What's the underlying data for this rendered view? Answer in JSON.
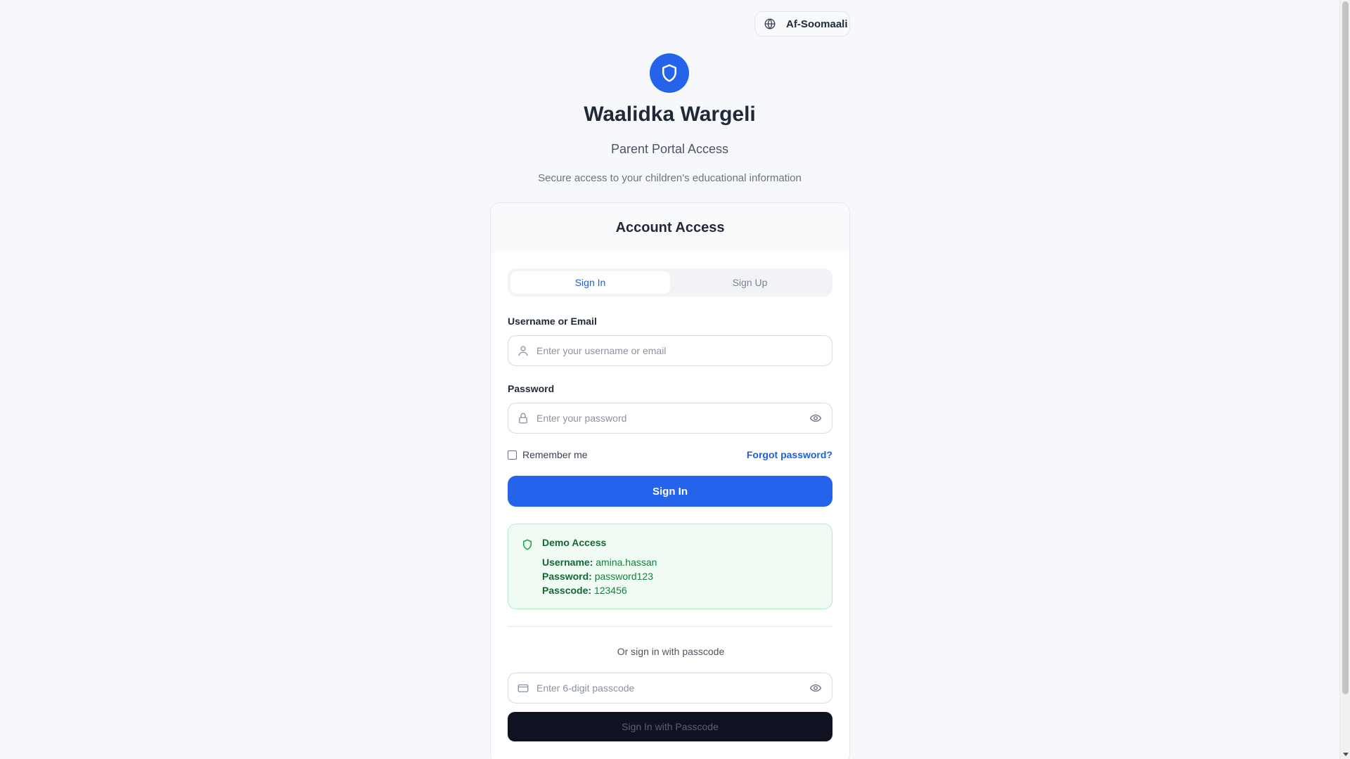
{
  "language": {
    "label": "Af-Soomaali",
    "icon": "globe-icon"
  },
  "brand": {
    "title": "Waalidka Wargeli",
    "subtitle": "Parent Portal Access",
    "description": "Secure access to your children's educational information",
    "accent": "#2563eb"
  },
  "card": {
    "heading": "Account Access",
    "tabs": [
      {
        "label": "Sign In",
        "active": true
      },
      {
        "label": "Sign Up",
        "active": false
      }
    ],
    "username": {
      "label": "Username or Email",
      "placeholder": "Enter your username or email",
      "icon": "user-icon"
    },
    "password": {
      "label": "Password",
      "placeholder": "Enter your password",
      "icon": "lock-icon"
    },
    "remember_label": "Remember me",
    "forgot_label": "Forgot password?",
    "signin_label": "Sign In",
    "demo": {
      "title": "Demo Access",
      "username_key": "Username:",
      "username_val": "amina.hassan",
      "password_key": "Password:",
      "password_val": "password123",
      "passcode_key": "Passcode:",
      "passcode_val": "123456",
      "color": "#166534"
    },
    "or_text": "Or sign in with passcode",
    "passcode": {
      "placeholder": "Enter 6-digit passcode",
      "icon": "card-icon"
    },
    "passcode_signin_label": "Sign In with Passcode"
  }
}
